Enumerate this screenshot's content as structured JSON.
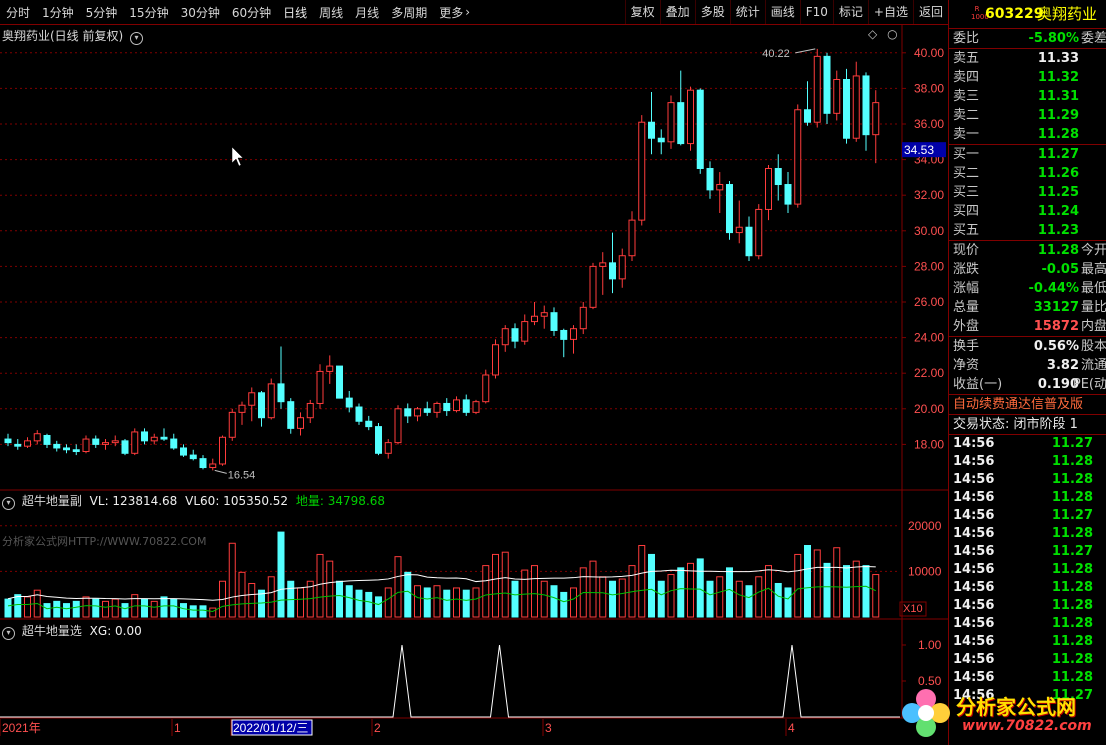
{
  "toolbar": {
    "periods": [
      "分时",
      "1分钟",
      "5分钟",
      "15分钟",
      "30分钟",
      "60分钟",
      "日线",
      "周线",
      "月线",
      "多周期",
      "更多"
    ],
    "active_period": "日线",
    "buttons": [
      "复权",
      "叠加",
      "多股",
      "统计",
      "画线",
      "F10",
      "标记",
      "+自选",
      "返回"
    ]
  },
  "main_title": "奥翔药业(日线 前复权)",
  "price_axis": [
    "40.00",
    "38.00",
    "36.00",
    "34.00",
    "32.00",
    "30.00",
    "28.00",
    "26.00",
    "24.00",
    "22.00",
    "20.00",
    "18.00"
  ],
  "current_price_tag": "34.53",
  "high_label": "40.22",
  "low_label": "16.54",
  "vol_panel": {
    "title": "超牛地量副",
    "vl": "VL: 123814.68",
    "vl60": "VL60: 105350.52",
    "diliang": "地量: 34798.68",
    "axis": [
      "20000",
      "10000"
    ],
    "unit": "X10",
    "watermark": "分析家公式网HTTP://WWW.70822.COM"
  },
  "xg_panel": {
    "title": "超牛地量选",
    "xg": "XG: 0.00",
    "axis": [
      "1.00",
      "0.50"
    ]
  },
  "date_axis": {
    "year": "2021年",
    "m1": "1",
    "cursor_date": "2022/01/12/三",
    "m2": "2",
    "m3": "3",
    "m4": "4"
  },
  "quote": {
    "code": "603229",
    "name": "奥翔药业",
    "badge_top": "R",
    "badge_bot": "1000",
    "weibi": {
      "label": "委比",
      "value": "-5.80%",
      "label2": "委差"
    },
    "asks": [
      {
        "label": "卖五",
        "value": "11.33"
      },
      {
        "label": "卖四",
        "value": "11.32"
      },
      {
        "label": "卖三",
        "value": "11.31"
      },
      {
        "label": "卖二",
        "value": "11.29"
      },
      {
        "label": "卖一",
        "value": "11.28"
      }
    ],
    "bids": [
      {
        "label": "买一",
        "value": "11.27"
      },
      {
        "label": "买二",
        "value": "11.26"
      },
      {
        "label": "买三",
        "value": "11.25"
      },
      {
        "label": "买四",
        "value": "11.24"
      },
      {
        "label": "买五",
        "value": "11.23"
      }
    ],
    "stats1": [
      {
        "label": "现价",
        "value": "11.28",
        "label2": "今开"
      },
      {
        "label": "涨跌",
        "value": "-0.05",
        "label2": "最高"
      },
      {
        "label": "涨幅",
        "value": "-0.44%",
        "label2": "最低"
      },
      {
        "label": "总量",
        "value": "33127",
        "label2": "量比"
      },
      {
        "label": "外盘",
        "value": "15872",
        "label2": "内盘"
      }
    ],
    "stats2": [
      {
        "label": "换手",
        "value": "0.56%",
        "label2": "股本"
      },
      {
        "label": "净资",
        "value": "3.82",
        "label2": "流通"
      },
      {
        "label": "收益(一)",
        "value": "0.190",
        "label2": "PE(动"
      }
    ],
    "notice": "自动续费通达信普及版",
    "status": "交易状态: 闭市阶段 1",
    "ticks": [
      {
        "time": "14:56",
        "price": "11.27"
      },
      {
        "time": "14:56",
        "price": "11.28"
      },
      {
        "time": "14:56",
        "price": "11.28"
      },
      {
        "time": "14:56",
        "price": "11.28"
      },
      {
        "time": "14:56",
        "price": "11.27"
      },
      {
        "time": "14:56",
        "price": "11.28"
      },
      {
        "time": "14:56",
        "price": "11.27"
      },
      {
        "time": "14:56",
        "price": "11.28"
      },
      {
        "time": "14:56",
        "price": "11.28"
      },
      {
        "time": "14:56",
        "price": "11.28"
      },
      {
        "time": "14:56",
        "price": "11.28"
      },
      {
        "time": "14:56",
        "price": "11.28"
      },
      {
        "time": "14:56",
        "price": "11.28"
      },
      {
        "time": "14:56",
        "price": "11.28"
      },
      {
        "time": "14:56",
        "price": "11.27"
      }
    ]
  },
  "watermark": {
    "title": "分析家公式网",
    "url": "www.70822.com"
  },
  "colors": {
    "up": "#ff3c3c",
    "down": "#54ffff",
    "grid": "#800000",
    "axis": "#ff3c3c",
    "ma": "#ffffff",
    "ma2": "#00c000"
  },
  "chart_data": {
    "type": "candlestick",
    "y_range": [
      16,
      41
    ],
    "candles": [
      [
        18.3,
        18.6,
        17.9,
        18.1
      ],
      [
        18.0,
        18.3,
        17.7,
        17.9
      ],
      [
        17.9,
        18.4,
        17.8,
        18.2
      ],
      [
        18.2,
        18.8,
        18.0,
        18.6
      ],
      [
        18.5,
        18.6,
        17.8,
        18.0
      ],
      [
        18.0,
        18.2,
        17.6,
        17.8
      ],
      [
        17.8,
        18.0,
        17.5,
        17.7
      ],
      [
        17.7,
        18.0,
        17.4,
        17.6
      ],
      [
        17.6,
        18.5,
        17.5,
        18.3
      ],
      [
        18.3,
        18.5,
        17.8,
        18.0
      ],
      [
        18.0,
        18.3,
        17.7,
        18.1
      ],
      [
        18.1,
        18.5,
        17.9,
        18.2
      ],
      [
        18.2,
        18.3,
        17.4,
        17.5
      ],
      [
        17.5,
        18.9,
        17.4,
        18.7
      ],
      [
        18.7,
        18.9,
        18.0,
        18.2
      ],
      [
        18.2,
        18.6,
        18.0,
        18.4
      ],
      [
        18.4,
        18.9,
        18.2,
        18.3
      ],
      [
        18.3,
        18.6,
        17.7,
        17.8
      ],
      [
        17.8,
        18.0,
        17.3,
        17.4
      ],
      [
        17.4,
        17.7,
        17.1,
        17.2
      ],
      [
        17.2,
        17.4,
        16.6,
        16.7
      ],
      [
        16.7,
        17.2,
        16.54,
        16.9
      ],
      [
        16.9,
        18.5,
        16.8,
        18.4
      ],
      [
        18.4,
        20.0,
        18.2,
        19.8
      ],
      [
        19.8,
        20.4,
        19.1,
        20.2
      ],
      [
        20.2,
        21.2,
        19.3,
        20.9
      ],
      [
        20.9,
        21.0,
        19.0,
        19.5
      ],
      [
        19.5,
        21.7,
        19.4,
        21.4
      ],
      [
        21.4,
        23.5,
        20.0,
        20.4
      ],
      [
        20.4,
        20.6,
        18.6,
        18.9
      ],
      [
        18.9,
        19.8,
        18.5,
        19.5
      ],
      [
        19.5,
        20.5,
        19.2,
        20.3
      ],
      [
        20.3,
        22.5,
        20.0,
        22.1
      ],
      [
        22.1,
        23.0,
        21.4,
        22.4
      ],
      [
        22.4,
        22.4,
        20.6,
        20.6
      ],
      [
        20.6,
        21.0,
        19.8,
        20.1
      ],
      [
        20.1,
        20.3,
        19.1,
        19.3
      ],
      [
        19.3,
        19.6,
        18.8,
        19.0
      ],
      [
        19.0,
        19.2,
        17.4,
        17.5
      ],
      [
        17.5,
        18.3,
        17.2,
        18.1
      ],
      [
        18.1,
        20.2,
        18.0,
        20.0
      ],
      [
        20.0,
        20.3,
        19.2,
        19.6
      ],
      [
        19.6,
        20.1,
        19.3,
        20.0
      ],
      [
        20.0,
        20.4,
        19.6,
        19.8
      ],
      [
        19.8,
        20.4,
        19.5,
        20.3
      ],
      [
        20.3,
        20.6,
        19.6,
        19.9
      ],
      [
        19.9,
        20.7,
        19.8,
        20.5
      ],
      [
        20.5,
        20.8,
        19.6,
        19.8
      ],
      [
        19.8,
        20.5,
        19.7,
        20.4
      ],
      [
        20.4,
        22.2,
        20.3,
        21.9
      ],
      [
        21.9,
        23.9,
        21.7,
        23.6
      ],
      [
        23.6,
        24.7,
        23.2,
        24.5
      ],
      [
        24.5,
        24.8,
        23.4,
        23.8
      ],
      [
        23.8,
        25.3,
        23.6,
        24.9
      ],
      [
        24.9,
        26.0,
        24.7,
        25.2
      ],
      [
        25.2,
        25.8,
        24.5,
        25.4
      ],
      [
        25.4,
        25.7,
        24.1,
        24.4
      ],
      [
        24.4,
        24.5,
        22.9,
        23.9
      ],
      [
        23.9,
        24.7,
        23.1,
        24.5
      ],
      [
        24.5,
        26.0,
        24.2,
        25.7
      ],
      [
        25.7,
        28.2,
        25.6,
        28.0
      ],
      [
        28.0,
        28.8,
        26.4,
        28.2
      ],
      [
        28.2,
        29.9,
        26.5,
        27.3
      ],
      [
        27.3,
        29.0,
        26.8,
        28.6
      ],
      [
        28.6,
        31.1,
        28.3,
        30.6
      ],
      [
        30.6,
        36.5,
        30.3,
        36.1
      ],
      [
        36.1,
        37.8,
        34.3,
        35.2
      ],
      [
        35.2,
        35.7,
        34.3,
        35.0
      ],
      [
        35.0,
        37.6,
        34.6,
        37.2
      ],
      [
        37.2,
        39.0,
        34.8,
        34.9
      ],
      [
        34.9,
        38.1,
        34.5,
        37.9
      ],
      [
        37.9,
        38.0,
        33.2,
        33.5
      ],
      [
        33.5,
        33.9,
        31.8,
        32.3
      ],
      [
        32.3,
        33.3,
        31.0,
        32.6
      ],
      [
        32.6,
        32.8,
        29.5,
        29.9
      ],
      [
        29.9,
        31.7,
        29.3,
        30.2
      ],
      [
        30.2,
        30.8,
        28.3,
        28.6
      ],
      [
        28.6,
        31.5,
        28.4,
        31.2
      ],
      [
        31.2,
        33.7,
        30.6,
        33.5
      ],
      [
        33.5,
        34.3,
        31.7,
        32.6
      ],
      [
        32.6,
        33.3,
        31.0,
        31.5
      ],
      [
        31.5,
        37.1,
        31.3,
        36.8
      ],
      [
        36.8,
        38.4,
        35.9,
        36.1
      ],
      [
        36.1,
        40.22,
        35.8,
        39.8
      ],
      [
        39.8,
        40.0,
        36.0,
        36.6
      ],
      [
        36.6,
        39.0,
        36.2,
        38.5
      ],
      [
        38.5,
        39.1,
        34.9,
        35.2
      ],
      [
        35.2,
        39.5,
        35.0,
        38.7
      ],
      [
        38.7,
        38.9,
        34.5,
        35.4
      ],
      [
        35.4,
        37.9,
        33.8,
        37.2
      ]
    ],
    "volumes": [
      0.8,
      1.0,
      0.9,
      1.2,
      0.6,
      0.7,
      0.6,
      0.7,
      0.9,
      0.8,
      0.7,
      0.8,
      0.6,
      1.0,
      0.8,
      0.7,
      0.9,
      0.8,
      0.6,
      0.5,
      0.5,
      0.4,
      1.6,
      3.3,
      2.0,
      1.5,
      1.2,
      1.8,
      3.8,
      1.6,
      1.3,
      1.6,
      2.8,
      2.5,
      1.6,
      1.4,
      1.2,
      1.1,
      0.9,
      1.3,
      2.7,
      2.0,
      1.4,
      1.3,
      1.4,
      1.2,
      1.3,
      1.2,
      1.3,
      2.3,
      2.8,
      2.9,
      1.6,
      2.1,
      2.3,
      1.6,
      1.4,
      1.1,
      1.3,
      2.2,
      2.5,
      1.8,
      1.6,
      1.7,
      2.3,
      3.2,
      2.8,
      1.6,
      1.9,
      2.2,
      2.4,
      2.6,
      1.6,
      1.8,
      2.2,
      1.6,
      1.4,
      1.8,
      2.3,
      1.5,
      1.3,
      2.8,
      3.2,
      3.0,
      2.4,
      3.1,
      2.3,
      2.5,
      2.3,
      1.9
    ],
    "vol_ylim": [
      0,
      25000
    ],
    "xg_signals": [
      40,
      50,
      80
    ]
  }
}
